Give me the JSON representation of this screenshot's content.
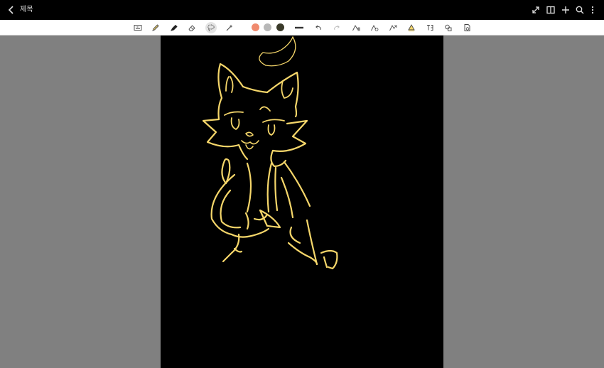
{
  "header": {
    "title": "제목"
  },
  "toolbar": {
    "tools": [
      "text-mode",
      "pen",
      "highlighter",
      "eraser",
      "lasso",
      "shape-recognition"
    ],
    "selected_tool": "lasso",
    "colors": [
      "#f08a6e",
      "#b8b8b8",
      "#3a3a2a"
    ],
    "stroke_color": "#f5d66a"
  },
  "canvas": {
    "background": "#000000"
  }
}
